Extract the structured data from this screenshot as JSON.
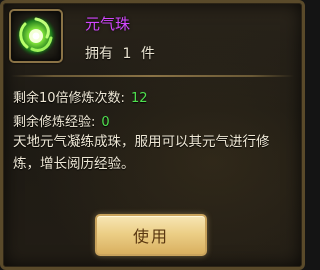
{
  "item": {
    "icon": "green-qi-orb-icon",
    "name": "元气珠",
    "name_color": "#d247ff",
    "own_label": "拥有",
    "own_count": "1",
    "own_unit": "件"
  },
  "stats": {
    "remaining_10x_label": "剩余10倍修炼次数:",
    "remaining_10x_value": "12",
    "remaining_exp_label": "剩余修炼经验:",
    "remaining_exp_value": "0",
    "value_color": "#4fe04f"
  },
  "description": "天地元气凝练成珠，服用可以其元气进行修炼，增长阅历经验。",
  "actions": {
    "use_label": "使用"
  }
}
